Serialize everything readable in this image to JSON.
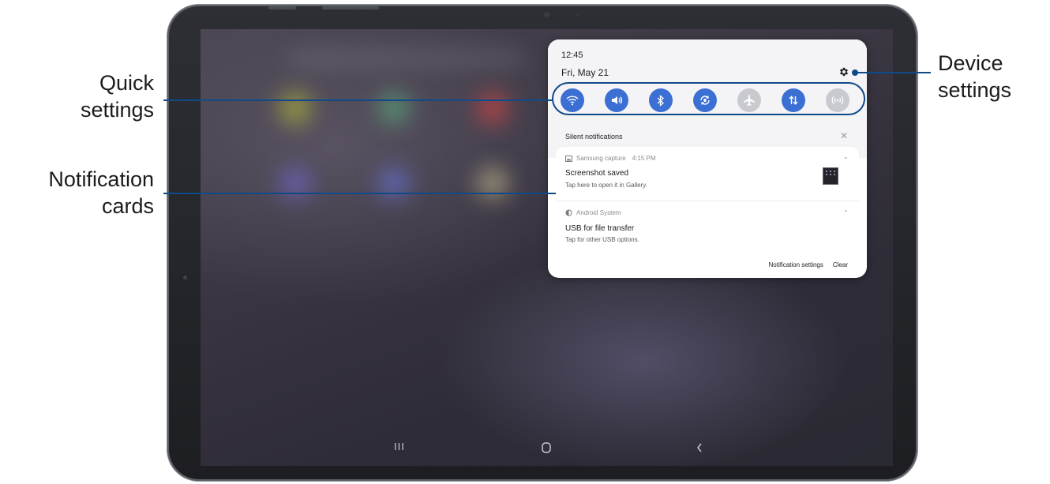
{
  "callouts": {
    "quick_settings": [
      "Quick",
      "settings"
    ],
    "notification_cards": [
      "Notification",
      "cards"
    ],
    "device_settings": [
      "Device",
      "settings"
    ]
  },
  "panel": {
    "time": "12:45",
    "date": "Fri, May 21",
    "settings_icon": "gear-icon",
    "quick_settings": [
      {
        "icon": "wifi-icon",
        "state": "on"
      },
      {
        "icon": "sound-icon",
        "state": "on"
      },
      {
        "icon": "bluetooth-icon",
        "state": "on"
      },
      {
        "icon": "auto-rotate-icon",
        "state": "on"
      },
      {
        "icon": "airplane-icon",
        "state": "off"
      },
      {
        "icon": "mobile-data-icon",
        "state": "on"
      },
      {
        "icon": "hotspot-icon",
        "state": "off"
      }
    ],
    "silent_header": "Silent notifications",
    "silent_close": "✕",
    "notifications": [
      {
        "app": "Samsung capture",
        "time": "4:15 PM",
        "title": "Screenshot saved",
        "text": "Tap here to open it in Gallery.",
        "chevron": "⌄"
      },
      {
        "app": "Android System",
        "title": "USB for file transfer",
        "text": "Tap for other USB options.",
        "chevron": "⌃"
      }
    ],
    "actions": {
      "settings": "Notification settings",
      "clear": "Clear"
    }
  },
  "navbar": {
    "recents": "III",
    "home": "home-icon",
    "back": "back-icon"
  },
  "colors": {
    "accent": "#3b6fd4",
    "callout_line": "#0f4a8a",
    "toggle_off": "#c9cacf"
  }
}
